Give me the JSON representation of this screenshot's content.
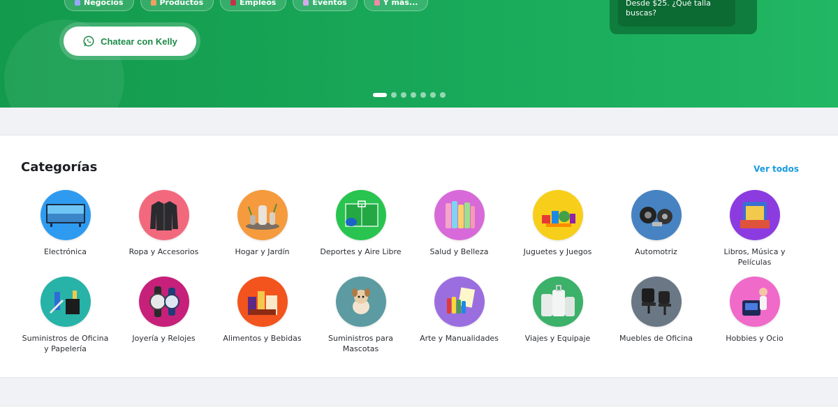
{
  "hero": {
    "pills": [
      {
        "label": "Negocios",
        "icon": "briefcase-icon",
        "color": "#9aa7ff"
      },
      {
        "label": "Productos",
        "icon": "box-icon",
        "color": "#f0a060"
      },
      {
        "label": "Empleos",
        "icon": "badge-icon",
        "color": "#c2334a"
      },
      {
        "label": "Eventos",
        "icon": "calendar-icon",
        "color": "#d8a8f0"
      },
      {
        "label": "Y más...",
        "icon": "more-icon",
        "color": "#f08aa8"
      }
    ],
    "chat_label": "Chatear con Kelly",
    "promo_text": "Desde $25. ¿Qué talla buscas?",
    "slides": 7,
    "active_slide": 1
  },
  "categories": {
    "title": "Categorías",
    "see_all": "Ver todos",
    "items": [
      {
        "label": "Electrónica",
        "color": "#2f9bf0",
        "icon": "tv-icon"
      },
      {
        "label": "Ropa y Accesorios",
        "color": "#f2697e",
        "icon": "jacket-icon"
      },
      {
        "label": "Hogar y Jardín",
        "color": "#f59b3d",
        "icon": "home-decor-icon"
      },
      {
        "label": "Deportes y Aire Libre",
        "color": "#29c44f",
        "icon": "soccer-field-icon"
      },
      {
        "label": "Salud y Belleza",
        "color": "#d76ad8",
        "icon": "cosmetics-icon"
      },
      {
        "label": "Juguetes y Juegos",
        "color": "#f7cf1b",
        "icon": "toys-icon"
      },
      {
        "label": "Automotriz",
        "color": "#4783c2",
        "icon": "car-parts-icon"
      },
      {
        "label": "Libros, Música y Películas",
        "color": "#8c3be0",
        "icon": "books-icon"
      },
      {
        "label": "Suministros de Oficina y Papelería",
        "color": "#27b3a8",
        "icon": "office-supplies-icon"
      },
      {
        "label": "Joyería y Relojes",
        "color": "#c6207a",
        "icon": "watch-icon"
      },
      {
        "label": "Alimentos y Bebidas",
        "color": "#f3541d",
        "icon": "food-icon"
      },
      {
        "label": "Suministros para Mascotas",
        "color": "#5c9ba1",
        "icon": "pet-icon"
      },
      {
        "label": "Arte y Manualidades",
        "color": "#9b6ee0",
        "icon": "art-icon"
      },
      {
        "label": "Viajes y Equipaje",
        "color": "#3bb16a",
        "icon": "luggage-icon"
      },
      {
        "label": "Muebles de Oficina",
        "color": "#6a7784",
        "icon": "office-chair-icon"
      },
      {
        "label": "Hobbies y Ocio",
        "color": "#f06ac9",
        "icon": "hobby-icon"
      }
    ]
  }
}
